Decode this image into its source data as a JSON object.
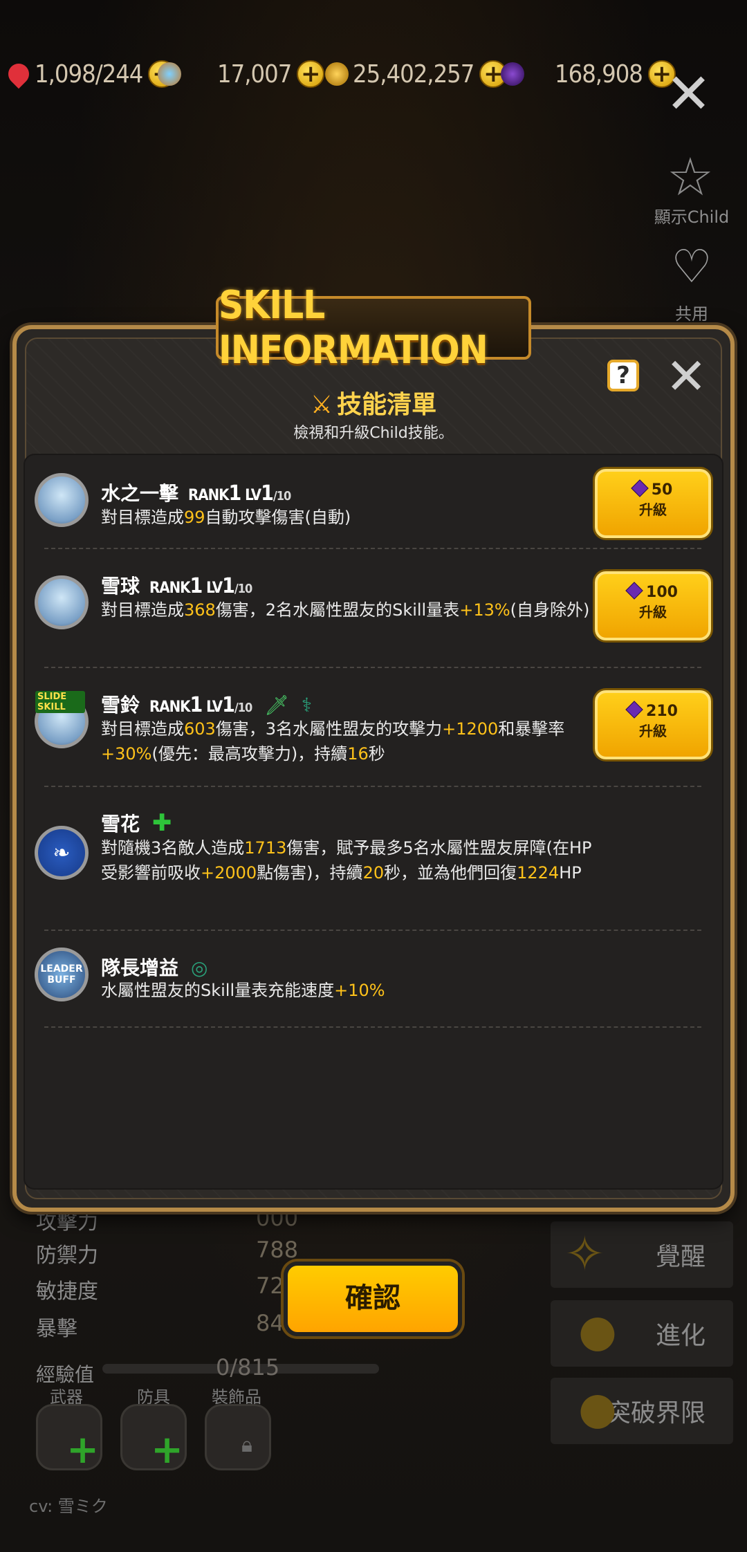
{
  "currency": {
    "stamina": "1,098/244",
    "crystal": "17,007",
    "gold": "25,402,257",
    "gem": "168,908"
  },
  "side": {
    "show_child": "顯示Child",
    "shared": "共用"
  },
  "modal": {
    "banner": "SKILL INFORMATION",
    "help": "?",
    "title": "技能清單",
    "subtitle": "檢視和升級Child技能。",
    "upgrade_label": "升級",
    "skills": [
      {
        "name": "水之一擊",
        "rank_prefix": "RANK",
        "rank": "1",
        "lv_prefix": "LV",
        "lv": "1",
        "lv_max": "/10",
        "desc_a": "對目標造成",
        "v1": "99",
        "desc_b": "自動攻擊傷害(自動)",
        "cost": "50"
      },
      {
        "name": "雪球",
        "rank_prefix": "RANK",
        "rank": "1",
        "lv_prefix": "LV",
        "lv": "1",
        "lv_max": "/10",
        "desc_a": "對目標造成",
        "v1": "368",
        "desc_b": "傷害，2名水屬性盟友的Skill量表",
        "v2": "+13%",
        "desc_c": "(自身除外)",
        "cost": "100"
      },
      {
        "name": "雪鈴",
        "rank_prefix": "RANK",
        "rank": "1",
        "lv_prefix": "LV",
        "lv": "1",
        "lv_max": "/10",
        "avatar_badge": "SLIDE SKILL",
        "desc_a": "對目標造成",
        "v1": "603",
        "desc_b": "傷害，3名水屬性盟友的攻擊力",
        "v2": "+1200",
        "desc_c": "和暴擊率",
        "v3": "+30%",
        "desc_d": "(優先：最高攻擊力)，持續",
        "v4": "16",
        "desc_e": "秒",
        "cost": "210"
      },
      {
        "name": "雪花",
        "desc_a": "對隨機3名敵人造成",
        "v1": "1713",
        "desc_b": "傷害，賦予最多5名水屬性盟友屏障(在HP受影響前吸收",
        "v2": "+2000",
        "desc_c": "點傷害)，持續",
        "v3": "20",
        "desc_d": "秒，並為他們回復",
        "v4": "1224",
        "desc_e": "HP"
      },
      {
        "name": "隊長增益",
        "avatar_text": "LEADER BUFF",
        "desc_a": "水屬性盟友的Skill量表充能速度",
        "v1": "+10%"
      }
    ]
  },
  "confirm": "確認",
  "stats": [
    {
      "label": "攻擊力",
      "value": "000"
    },
    {
      "label": "防禦力",
      "value": "788"
    },
    {
      "label": "敏捷度",
      "value": "726"
    },
    {
      "label": "暴擊",
      "value": "848"
    }
  ],
  "exp": {
    "label": "經驗值",
    "value": "0/815"
  },
  "equip": {
    "weapon": "武器",
    "armor": "防具",
    "accessory": "裝飾品"
  },
  "right_buttons": {
    "awaken": "覺醒",
    "evolve": "進化",
    "limit_break": "突破界限"
  },
  "cv": "cv: 雪ミク"
}
